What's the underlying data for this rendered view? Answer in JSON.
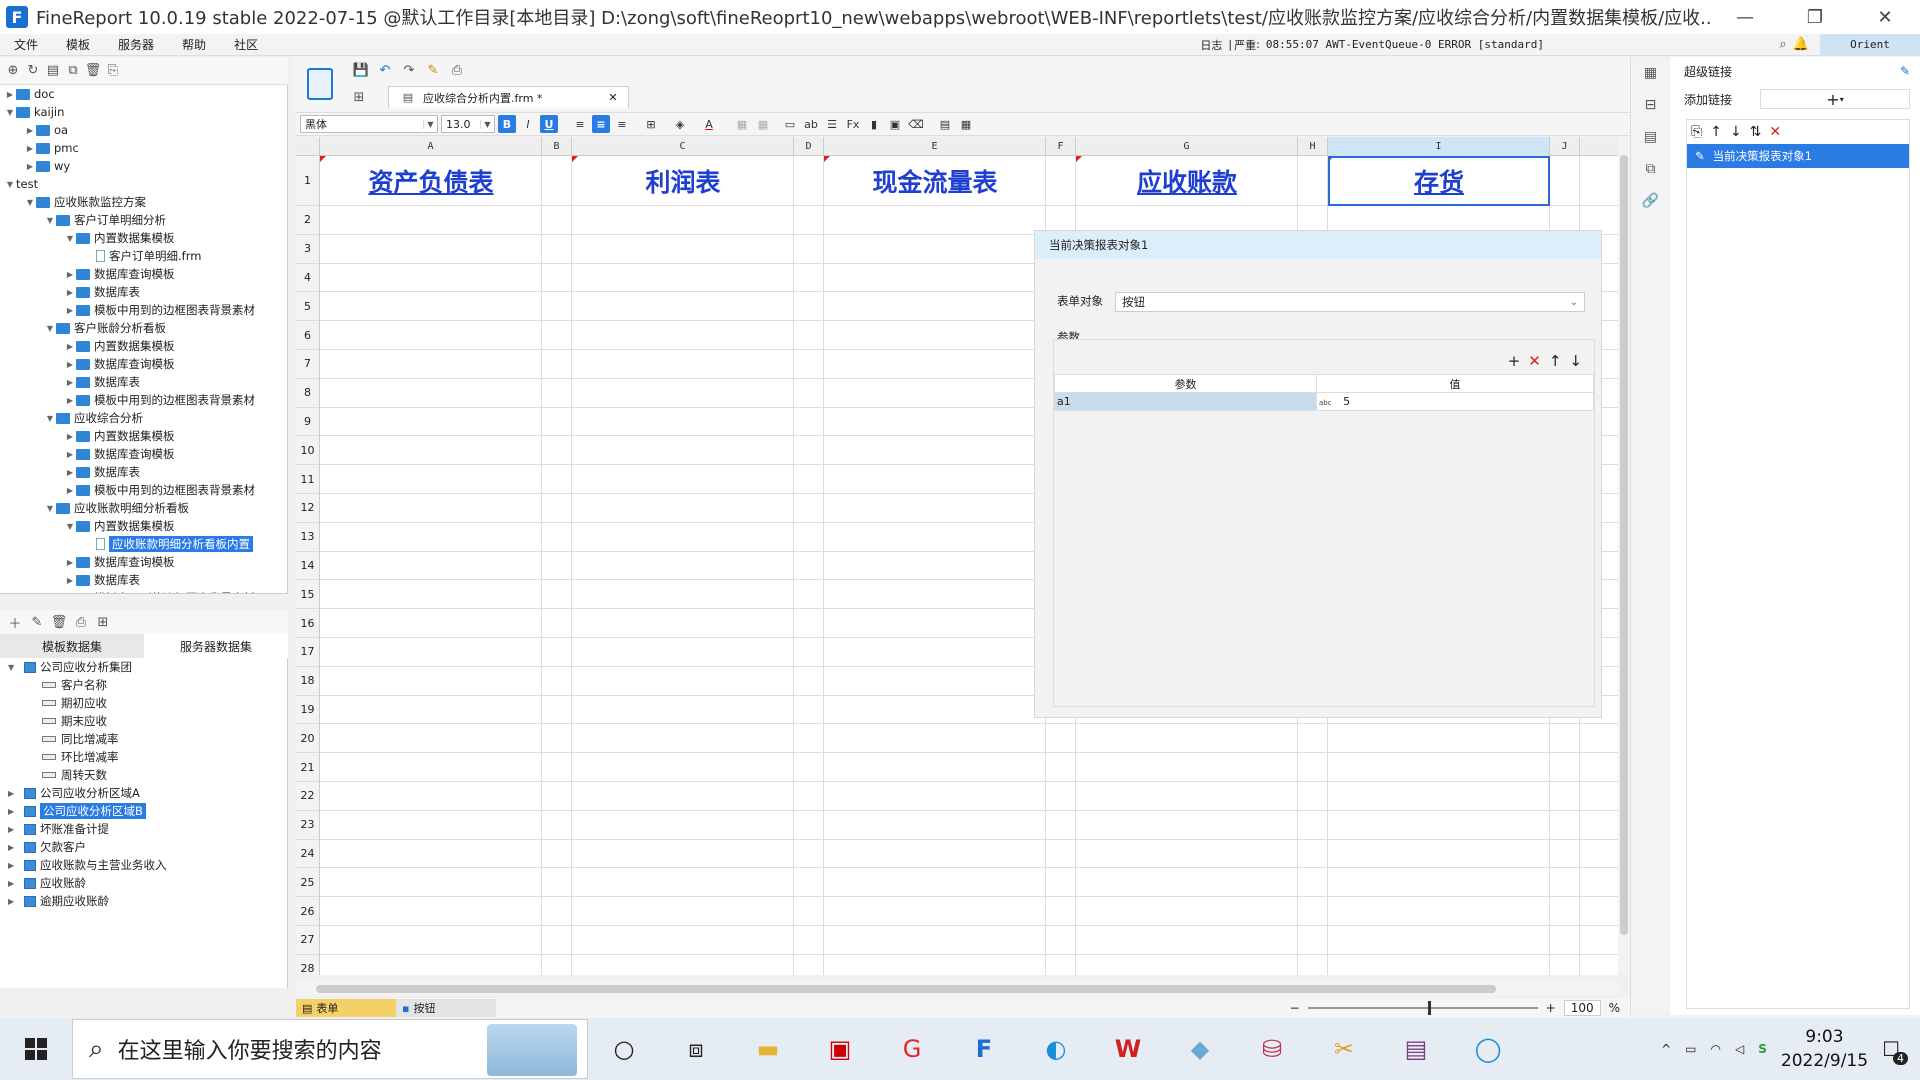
{
  "window": {
    "title": "FineReport 10.0.19 stable 2022-07-15 @默认工作目录[本地目录]     D:\\zong\\soft\\fineReoprt10_new\\webapps\\webroot\\WEB-INF\\reportlets\\test/应收账款监控方案/应收综合分析/内置数据集模板/应收..."
  },
  "menu": {
    "items": [
      "文件",
      "模板",
      "服务器",
      "帮助",
      "社区"
    ],
    "log_label": "日志",
    "severity_label": "严重",
    "log_text": "08:55:07 AWT-EventQueue-0 ERROR [standard]",
    "user": "Orient"
  },
  "file_tree": [
    {
      "label": "doc",
      "level": 0,
      "type": "folder",
      "exp": "closed"
    },
    {
      "label": "kaijin",
      "level": 0,
      "type": "folder",
      "exp": "open"
    },
    {
      "label": "oa",
      "level": 1,
      "type": "folder",
      "exp": "closed"
    },
    {
      "label": "pmc",
      "level": 1,
      "type": "folder",
      "exp": "closed"
    },
    {
      "label": "wy",
      "level": 1,
      "type": "folder",
      "exp": "closed"
    },
    {
      "label": "test",
      "level": 0,
      "type": "none",
      "exp": "open"
    },
    {
      "label": "应收账款监控方案",
      "level": 1,
      "type": "folder",
      "exp": "open"
    },
    {
      "label": "客户订单明细分析",
      "level": 2,
      "type": "folder",
      "exp": "open"
    },
    {
      "label": "内置数据集模板",
      "level": 3,
      "type": "folder",
      "exp": "open"
    },
    {
      "label": "客户订单明细.frm",
      "level": 4,
      "type": "file",
      "exp": ""
    },
    {
      "label": "数据库查询模板",
      "level": 3,
      "type": "folder",
      "exp": "closed"
    },
    {
      "label": "数据库表",
      "level": 3,
      "type": "folder",
      "exp": "closed"
    },
    {
      "label": "模板中用到的边框图表背景素材",
      "level": 3,
      "type": "folder",
      "exp": "closed"
    },
    {
      "label": "客户账龄分析看板",
      "level": 2,
      "type": "folder",
      "exp": "open"
    },
    {
      "label": "内置数据集模板",
      "level": 3,
      "type": "folder",
      "exp": "closed"
    },
    {
      "label": "数据库查询模板",
      "level": 3,
      "type": "folder",
      "exp": "closed"
    },
    {
      "label": "数据库表",
      "level": 3,
      "type": "folder",
      "exp": "closed"
    },
    {
      "label": "模板中用到的边框图表背景素材",
      "level": 3,
      "type": "folder",
      "exp": "closed"
    },
    {
      "label": "应收综合分析",
      "level": 2,
      "type": "folder",
      "exp": "open"
    },
    {
      "label": "内置数据集模板",
      "level": 3,
      "type": "folder",
      "exp": "closed"
    },
    {
      "label": "数据库查询模板",
      "level": 3,
      "type": "folder",
      "exp": "closed"
    },
    {
      "label": "数据库表",
      "level": 3,
      "type": "folder",
      "exp": "closed"
    },
    {
      "label": "模板中用到的边框图表背景素材",
      "level": 3,
      "type": "folder",
      "exp": "closed"
    },
    {
      "label": "应收账款明细分析看板",
      "level": 2,
      "type": "folder",
      "exp": "open"
    },
    {
      "label": "内置数据集模板",
      "level": 3,
      "type": "folder",
      "exp": "open"
    },
    {
      "label": "应收账款明细分析看板内置",
      "level": 4,
      "type": "file",
      "exp": "",
      "selected": true
    },
    {
      "label": "数据库查询模板",
      "level": 3,
      "type": "folder",
      "exp": "closed"
    },
    {
      "label": "数据库表",
      "level": 3,
      "type": "folder",
      "exp": "closed"
    },
    {
      "label": "模板中用到的边框图表背景素材",
      "level": 3,
      "type": "folder",
      "exp": "closed"
    }
  ],
  "dataset_tabs": [
    "模板数据集",
    "服务器数据集"
  ],
  "dataset_tree": [
    {
      "label": "公司应收分析集团",
      "kind": "table",
      "exp": "open"
    },
    {
      "label": "客户名称",
      "kind": "field"
    },
    {
      "label": "期初应收",
      "kind": "field"
    },
    {
      "label": "期末应收",
      "kind": "field"
    },
    {
      "label": "同比增减率",
      "kind": "field"
    },
    {
      "label": "环比增减率",
      "kind": "field"
    },
    {
      "label": "周转天数",
      "kind": "field"
    },
    {
      "label": "公司应收分析区域A",
      "kind": "table",
      "exp": "closed"
    },
    {
      "label": "公司应收分析区域B",
      "kind": "table",
      "exp": "closed",
      "selected": true
    },
    {
      "label": "坏账准备计提",
      "kind": "table",
      "exp": "closed"
    },
    {
      "label": "欠款客户",
      "kind": "table",
      "exp": "closed"
    },
    {
      "label": "应收账款与主营业务收入",
      "kind": "table",
      "exp": "closed"
    },
    {
      "label": "应收账龄",
      "kind": "table",
      "exp": "closed"
    },
    {
      "label": "逾期应收账龄",
      "kind": "table",
      "exp": "closed"
    }
  ],
  "editor_tab": {
    "label": "应收综合分析内置.frm *"
  },
  "format": {
    "font": "黑体",
    "size": "13.0"
  },
  "sheet": {
    "columns": [
      "A",
      "B",
      "C",
      "D",
      "E",
      "F",
      "G",
      "H",
      "I",
      "J"
    ],
    "selected_column": "I",
    "rows": [
      "1",
      "2",
      "3",
      "4",
      "5",
      "6",
      "7",
      "8",
      "9",
      "10",
      "11",
      "12",
      "13",
      "14",
      "15",
      "16",
      "17",
      "18",
      "19",
      "20",
      "21",
      "22",
      "23",
      "24",
      "25",
      "26",
      "27",
      "28"
    ],
    "links": [
      {
        "col": "A",
        "text": "资产负债表",
        "underline": true
      },
      {
        "col": "C",
        "text": "利润表",
        "underline": false
      },
      {
        "col": "E",
        "text": "现金流量表",
        "underline": false
      },
      {
        "col": "G",
        "text": "应收账款",
        "underline": true
      },
      {
        "col": "I",
        "text": "存货",
        "underline": true
      }
    ]
  },
  "popup": {
    "title": "当前决策报表对象1",
    "form_object_label": "表单对象",
    "form_object_value": "按钮",
    "params_label": "参数",
    "col_param": "参数",
    "col_value": "值",
    "rows": [
      {
        "param": "a1",
        "value": "5"
      }
    ]
  },
  "right_panel": {
    "title": "超级链接",
    "add_label": "添加链接",
    "items": [
      "当前决策报表对象1"
    ]
  },
  "bottom": {
    "tabs": [
      "表单",
      "按钮"
    ],
    "zoom": "100",
    "zoom_unit": "%"
  },
  "taskbar": {
    "search_placeholder": "在这里输入你要搜索的内容",
    "time": "9:03",
    "date": "2022/9/15",
    "notif_count": "4"
  }
}
